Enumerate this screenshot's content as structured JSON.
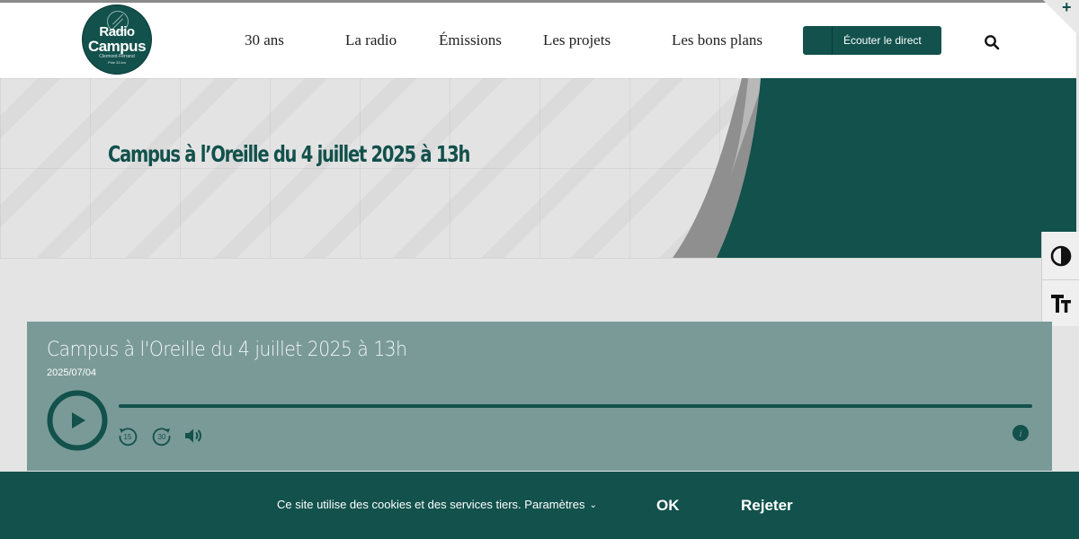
{
  "brand": {
    "line1": "Radio",
    "line2": "Campus",
    "line3": "Clermont-Ferrand",
    "line4": "Pôle 33 km",
    "accent": "#12514c"
  },
  "nav": {
    "items": [
      {
        "label": "30 ans"
      },
      {
        "label": "La radio"
      },
      {
        "label": "Émissions"
      },
      {
        "label": "Les projets"
      },
      {
        "label": "Les bons plans"
      }
    ],
    "listen_label": "Écouter le direct"
  },
  "hero": {
    "title": "Campus à l’Oreille du 4 juillet 2025 à 13h"
  },
  "accessibility": {
    "contrast_icon": "contrast-icon",
    "text_size_icon": "text-size-icon"
  },
  "player": {
    "title": "Campus à l'Oreille du 4 juillet 2025 à 13h",
    "date": "2025/07/04",
    "rewind_seconds": "15",
    "forward_seconds": "30"
  },
  "cookie": {
    "text": "Ce site utilise des cookies et des services tiers.",
    "params_label": "Paramètres",
    "ok_label": "OK",
    "reject_label": "Rejeter"
  }
}
